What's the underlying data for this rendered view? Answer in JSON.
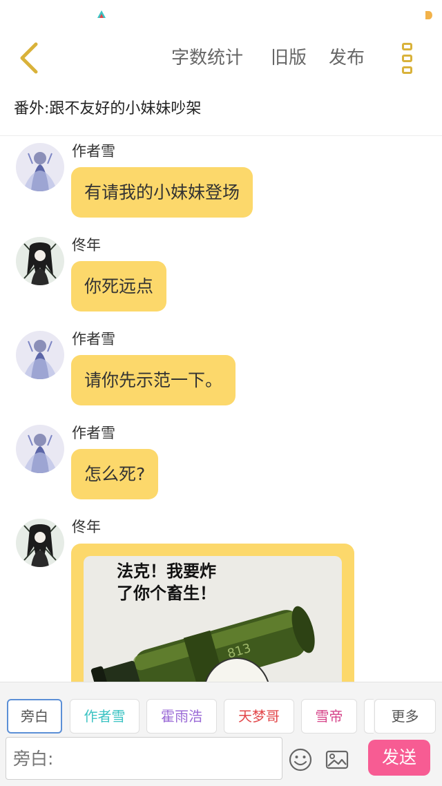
{
  "status_bar": {
    "left_icon": "app-triangle-icon",
    "right_icon": "battery-dot-icon",
    "accent_colors": [
      "#3cc3c3",
      "#f2b24a"
    ]
  },
  "nav": {
    "back_icon": "chevron-left-icon",
    "word_count": "字数统计",
    "old_version": "旧版",
    "publish": "发布",
    "more_icon": "more-vertical-icon",
    "icon_color": "#d9b23a"
  },
  "chapter": {
    "title": "番外:跟不友好的小妹妹吵架"
  },
  "messages": [
    {
      "sender": "作者雪",
      "avatar": "avatar-xue",
      "text": "有请我的小妹妹登场"
    },
    {
      "sender": "佟年",
      "avatar": "avatar-tongnian",
      "text": "你死远点"
    },
    {
      "sender": "作者雪",
      "avatar": "avatar-xue",
      "text": "请你先示范一下。"
    },
    {
      "sender": "作者雪",
      "avatar": "avatar-xue",
      "text": "怎么死?"
    },
    {
      "sender": "佟年",
      "avatar": "avatar-tongnian",
      "image_caption": "法克！我要炸\n了你个畜生！"
    }
  ],
  "bubble_color": "#fcd86b",
  "roles": [
    {
      "label": "旁白",
      "color": "#555555",
      "selected": true
    },
    {
      "label": "作者雪",
      "color": "#3cc3c3",
      "selected": false
    },
    {
      "label": "霍雨浩",
      "color": "#9a6ad6",
      "selected": false
    },
    {
      "label": "天梦哥",
      "color": "#e2474a",
      "selected": false
    },
    {
      "label": "雪帝",
      "color": "#d6458a",
      "selected": false
    },
    {
      "label": "更多",
      "color": "#555555",
      "selected": false
    }
  ],
  "composer": {
    "placeholder": "旁白:",
    "emoji_icon": "smiley-icon",
    "image_icon": "image-icon",
    "send": "发送",
    "send_color": "#f75c93"
  }
}
